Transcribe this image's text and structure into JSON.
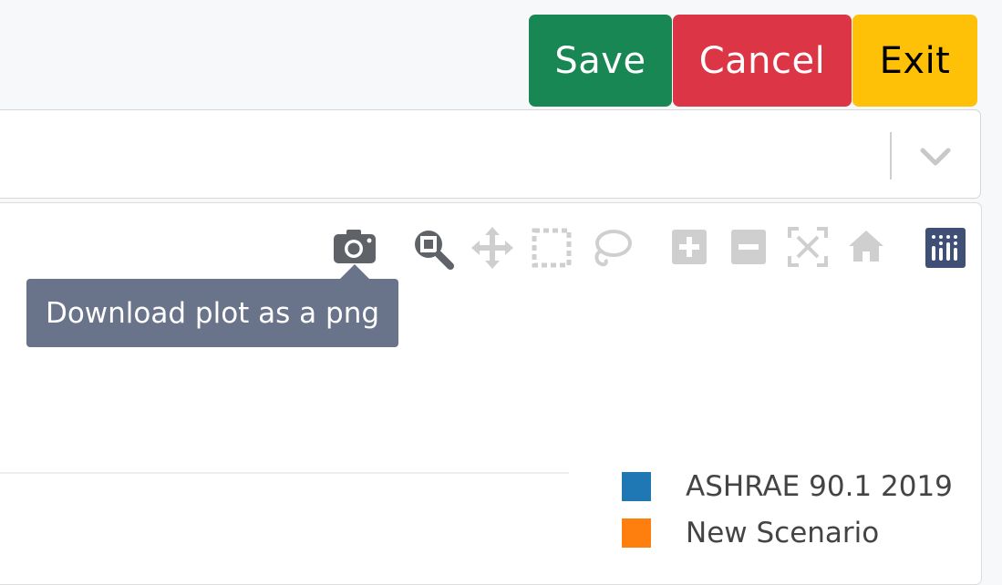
{
  "toolbar": {
    "save_label": "Save",
    "cancel_label": "Cancel",
    "exit_label": "Exit"
  },
  "colors": {
    "save": "#198754",
    "cancel": "#dc3545",
    "exit": "#ffc107",
    "tooltip_bg": "#69738a"
  },
  "scenario_select": {
    "selected_value": "",
    "dropdown_icon": "chevron-down-icon"
  },
  "plot": {
    "modebar": [
      {
        "name": "camera-icon",
        "title": "Download plot as a png"
      },
      {
        "name": "zoom-icon",
        "title": "Zoom"
      },
      {
        "name": "pan-icon",
        "title": "Pan"
      },
      {
        "name": "box-select-icon",
        "title": "Box Select"
      },
      {
        "name": "lasso-select-icon",
        "title": "Lasso Select"
      },
      {
        "name": "zoom-in-icon",
        "title": "Zoom in"
      },
      {
        "name": "zoom-out-icon",
        "title": "Zoom out"
      },
      {
        "name": "autoscale-icon",
        "title": "Autoscale"
      },
      {
        "name": "reset-axes-icon",
        "title": "Reset axes"
      },
      {
        "name": "plotly-logo-icon",
        "title": "Produced with Plotly"
      }
    ],
    "tooltip": "Download plot as a png",
    "legend": [
      {
        "label": "ASHRAE 90.1 2019",
        "color": "#1f77b4"
      },
      {
        "label": "New Scenario",
        "color": "#ff7f0e"
      }
    ]
  }
}
